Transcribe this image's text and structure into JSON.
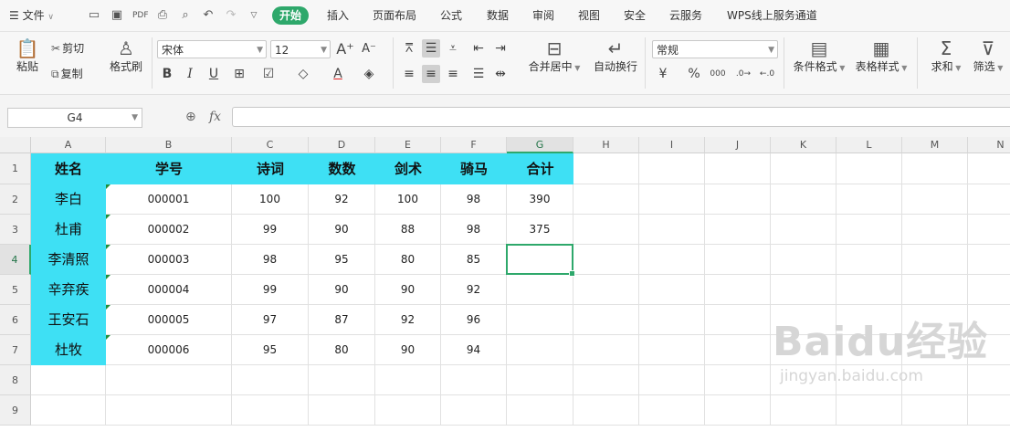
{
  "menu": {
    "file_label": "文件",
    "tabs": [
      "开始",
      "插入",
      "页面布局",
      "公式",
      "数据",
      "审阅",
      "视图",
      "安全",
      "云服务",
      "WPS线上服务通道"
    ],
    "active_tab": "开始"
  },
  "ribbon": {
    "paste": "粘贴",
    "cut": "剪切",
    "copy": "复制",
    "format_painter": "格式刷",
    "font_name": "宋体",
    "font_size": "12",
    "merge_center": "合并居中",
    "wrap_text": "自动换行",
    "number_format": "常规",
    "conditional_format": "条件格式",
    "table_style": "表格样式",
    "sum": "求和",
    "filter": "筛选"
  },
  "formula_bar": {
    "name_box": "G4",
    "fx_label": "fx",
    "value": ""
  },
  "sheet": {
    "columns": [
      "A",
      "B",
      "C",
      "D",
      "E",
      "F",
      "G",
      "H",
      "I",
      "J",
      "K",
      "L",
      "M",
      "N"
    ],
    "rows": [
      "1",
      "2",
      "3",
      "4",
      "5",
      "6",
      "7",
      "8",
      "9"
    ],
    "headers": [
      "姓名",
      "学号",
      "诗词",
      "数数",
      "剑术",
      "骑马",
      "合计"
    ],
    "data": [
      [
        "李白",
        "000001",
        "100",
        "92",
        "100",
        "98",
        "390"
      ],
      [
        "杜甫",
        "000002",
        "99",
        "90",
        "88",
        "98",
        "375"
      ],
      [
        "李清照",
        "000003",
        "98",
        "95",
        "80",
        "85",
        ""
      ],
      [
        "辛弃疾",
        "000004",
        "99",
        "90",
        "90",
        "92",
        ""
      ],
      [
        "王安石",
        "000005",
        "97",
        "87",
        "92",
        "96",
        ""
      ],
      [
        "杜牧",
        "000006",
        "95",
        "80",
        "90",
        "94",
        ""
      ]
    ],
    "selected_cell": "G4",
    "header_fill": "#3ee0f4",
    "accent": "#2ea86b"
  },
  "watermark": {
    "main": "Baidu经验",
    "sub": "jingyan.baidu.com"
  }
}
